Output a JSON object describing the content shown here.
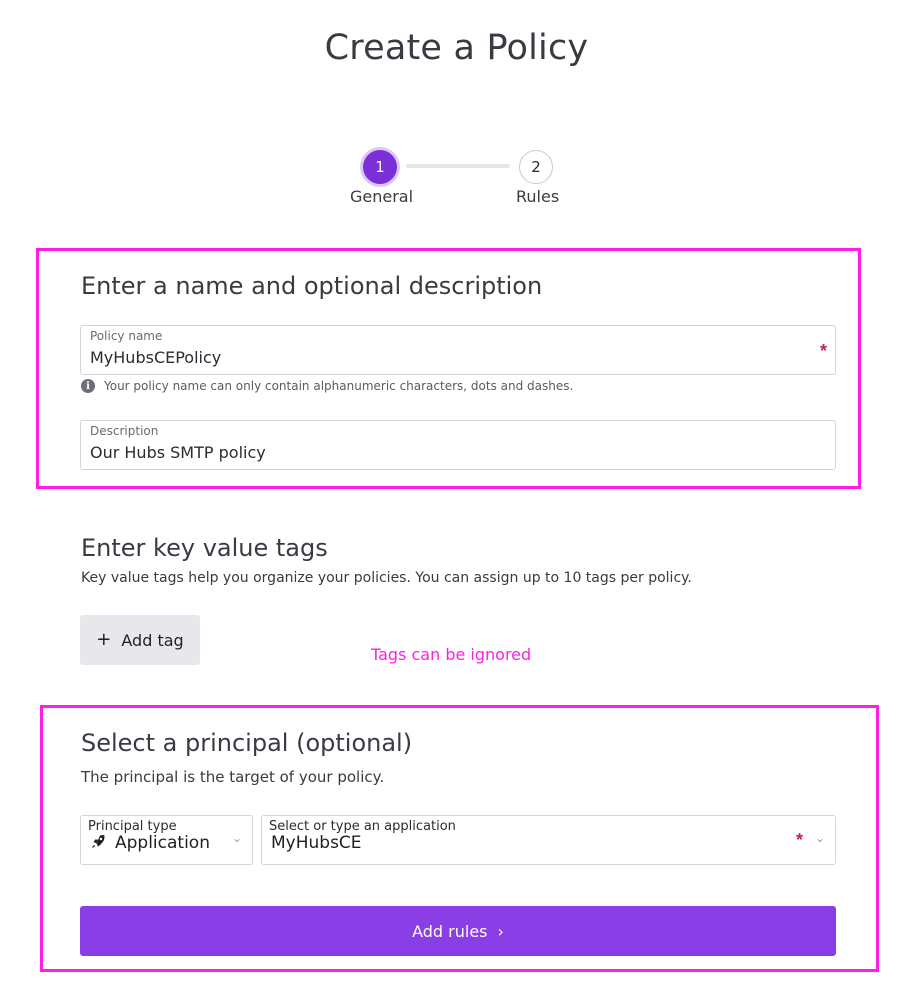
{
  "page": {
    "title": "Create a Policy"
  },
  "stepper": {
    "steps": [
      {
        "number": "1",
        "label": "General",
        "active": true
      },
      {
        "number": "2",
        "label": "Rules",
        "active": false
      }
    ]
  },
  "general": {
    "heading": "Enter a name and optional description",
    "policy_name": {
      "label": "Policy name",
      "value": "MyHubsCEPolicy",
      "required_mark": "*",
      "hint": "Your policy name can only contain alphanumeric characters, dots and dashes."
    },
    "description": {
      "label": "Description",
      "value": "Our Hubs SMTP policy"
    }
  },
  "tags": {
    "heading": "Enter key value tags",
    "subtitle": "Key value tags help you organize your policies. You can assign up to 10 tags per policy.",
    "add_tag_label": "Add tag",
    "annotation": "Tags can be ignored"
  },
  "principal": {
    "heading": "Select a principal (optional)",
    "subtitle": "The principal is the target of your policy.",
    "type": {
      "label": "Principal type",
      "value": "Application",
      "icon": "rocket-icon"
    },
    "application": {
      "label": "Select or type an application",
      "value": "MyHubsCE",
      "required_mark": "*"
    }
  },
  "actions": {
    "add_rules_label": "Add rules"
  },
  "colors": {
    "accent": "#8a3ee6",
    "step_active": "#7b2fd6",
    "highlight": "#ff1ee6",
    "required": "#c0205a"
  }
}
